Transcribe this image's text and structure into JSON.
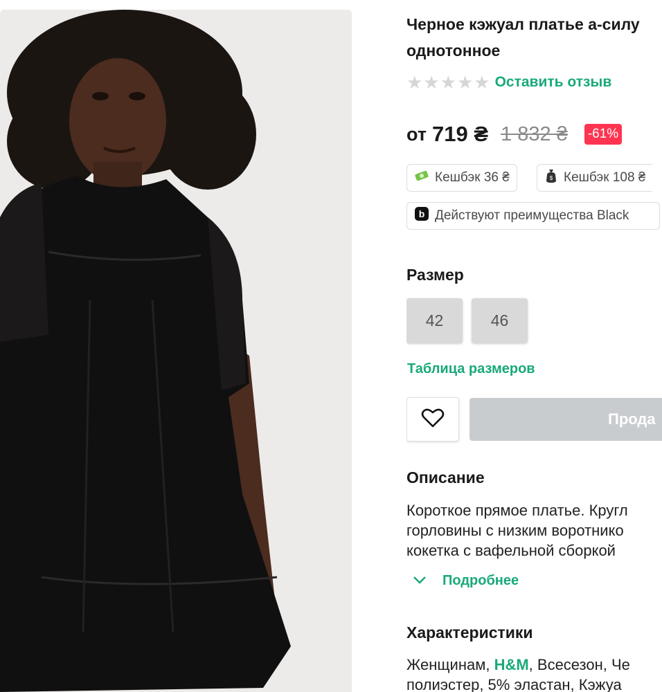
{
  "product": {
    "title_line1": "Черное кэжуал платье а-силу",
    "title_line2": "однотонное",
    "review_link": "Оставить отзыв",
    "price_prefix": "от",
    "price": "719 ₴",
    "old_price": "1 832 ₴",
    "discount": "-61%",
    "cashback_1": "Кешбэк 36 ₴",
    "cashback_2": "Кешбэк 108 ₴",
    "black_benefit": "Действуют преимущества Black",
    "rating_stars": 0
  },
  "size": {
    "heading": "Размер",
    "options": [
      "42",
      "46"
    ],
    "table_link": "Таблица размеров"
  },
  "actions": {
    "buy_label": "Прода"
  },
  "description": {
    "heading": "Описание",
    "line1": "Короткое прямое платье. Кругл",
    "line2": "горловины с низким воротнико",
    "line3": "кокетка с вафельной сборкой",
    "more": "Подробнее"
  },
  "specs": {
    "heading": "Характеристики",
    "line1_a": "Женщинам, ",
    "brand": "H&M",
    "line1_b": ", Всесезон, Че",
    "line2": "полиэстер, 5% эластан, Кэжуа"
  },
  "colors": {
    "accent": "#19a97b",
    "discount_bg": "#ff3450",
    "size_bg": "#d9d9d9",
    "buy_disabled": "#c9cccf"
  },
  "icons": [
    "money-icon",
    "money-bag-icon",
    "black-logo-icon",
    "heart-icon",
    "chevron-down-icon",
    "star-icon"
  ]
}
